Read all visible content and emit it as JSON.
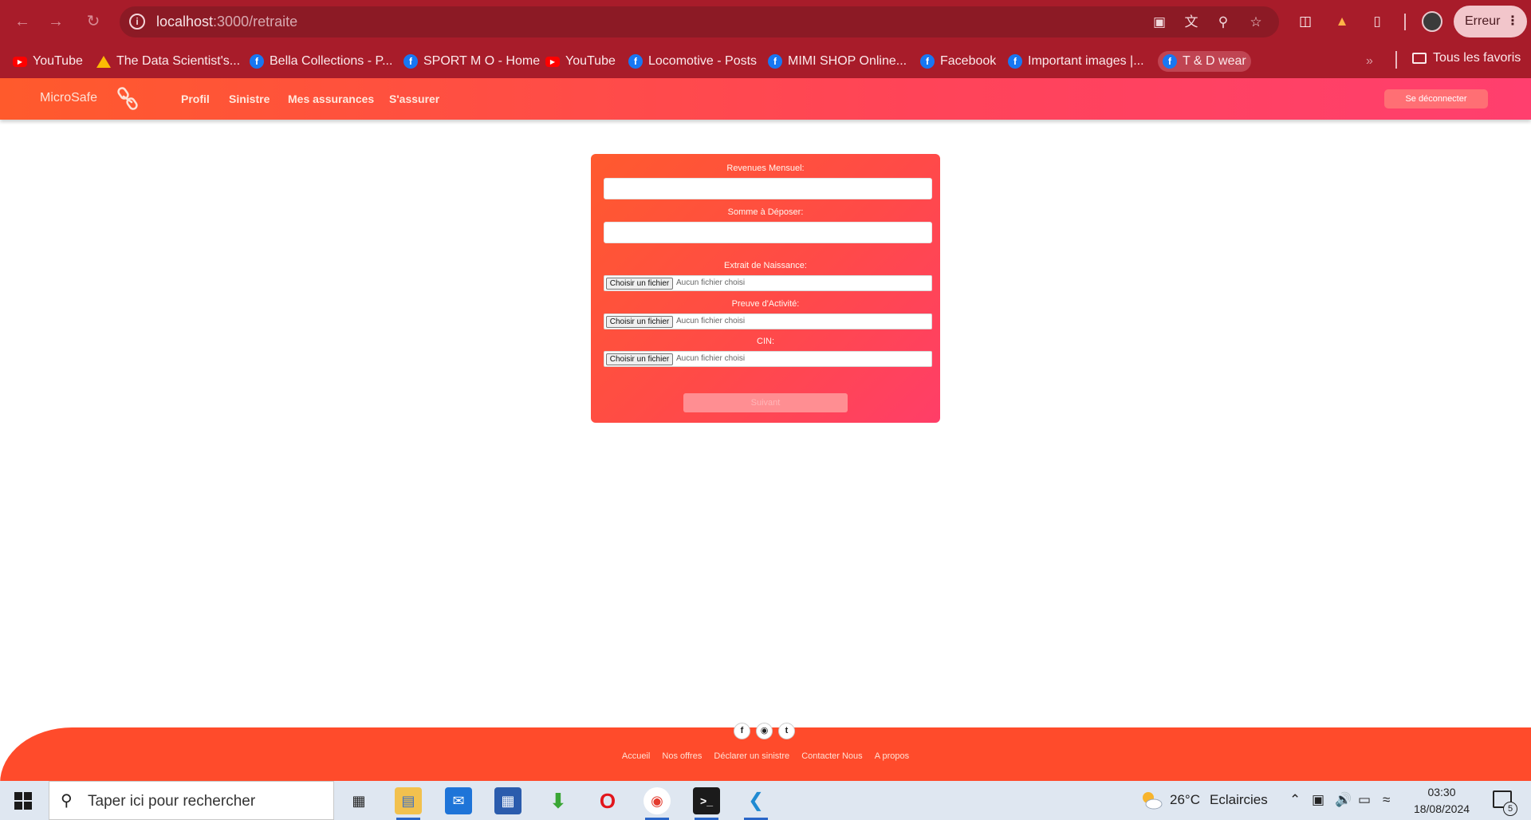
{
  "browser": {
    "url_host": "localhost",
    "url_path": ":3000/retraite",
    "error_label": "Erreur",
    "bookmarks": [
      {
        "label": "YouTube",
        "icon": "youtube-icon"
      },
      {
        "label": "The Data Scientist's...",
        "icon": "google-drive-icon"
      },
      {
        "label": "Bella Collections - P...",
        "icon": "facebook-icon"
      },
      {
        "label": "SPORT M O - Home",
        "icon": "facebook-icon"
      },
      {
        "label": "YouTube",
        "icon": "youtube-icon"
      },
      {
        "label": "Locomotive - Posts",
        "icon": "facebook-icon"
      },
      {
        "label": "MIMI SHOP Online...",
        "icon": "facebook-icon"
      },
      {
        "label": "Facebook",
        "icon": "facebook-icon"
      },
      {
        "label": "Important images |...",
        "icon": "facebook-icon"
      },
      {
        "label": "T & D wear",
        "icon": "facebook-icon"
      }
    ],
    "all_bookmarks_label": "Tous les favoris"
  },
  "navbar": {
    "brand": "MicroSafe",
    "links": [
      "Profil",
      "Sinistre",
      "Mes assurances",
      "S'assurer"
    ],
    "logout_label": "Se déconnecter"
  },
  "form": {
    "revenue_label": "Revenues Mensuel:",
    "deposit_label": "Somme à Déposer:",
    "birth_cert_label": "Extrait de Naissance:",
    "activity_proof_label": "Preuve d'Activité:",
    "cin_label": "CIN:",
    "file_button_label": "Choisir un fichier",
    "no_file_label": "Aucun fichier choisi",
    "next_label": "Suivant"
  },
  "footer": {
    "links": [
      "Accueil",
      "Nos offres",
      "Déclarer un sinistre",
      "Contacter Nous",
      "A propos"
    ],
    "socials": [
      "facebook-icon",
      "instagram-icon",
      "twitter-icon"
    ]
  },
  "taskbar": {
    "search_placeholder": "Taper ici pour rechercher",
    "weather_temp": "26°C",
    "weather_desc": "Eclaircies",
    "time": "03:30",
    "date": "18/08/2024",
    "notification_count": "5"
  },
  "colors": {
    "chrome_bg": "#a81c2a",
    "nav_gradient_start": "#ff5a2c",
    "nav_gradient_end": "#ff3f6e",
    "footer_bg": "#ff4b2b"
  }
}
